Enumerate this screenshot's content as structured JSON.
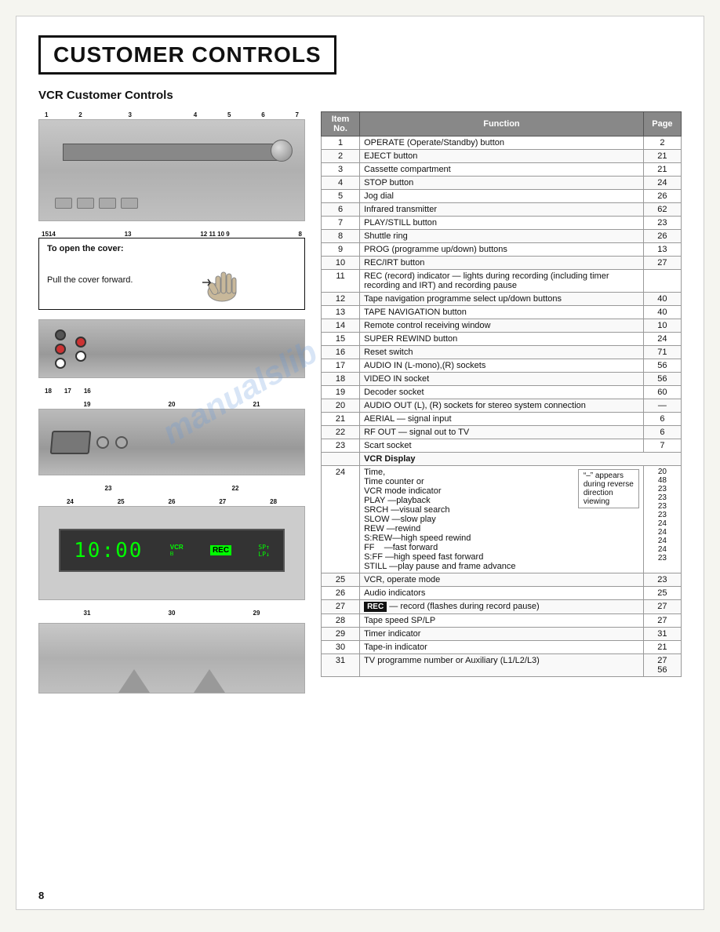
{
  "page": {
    "title": "CUSTOMER CONTROLS",
    "section_title": "VCR Customer Controls",
    "page_number": "8"
  },
  "cover_note": {
    "title": "To open the cover:",
    "text": "Pull the cover forward."
  },
  "top_diagram_numbers": {
    "top_row": [
      "1",
      "2",
      "3",
      "4",
      "5",
      "6",
      "7"
    ],
    "bottom_row": [
      "1514",
      "13",
      "1211 10  9",
      "8"
    ]
  },
  "back_diagram_numbers": [
    "18",
    "17",
    "16"
  ],
  "connector_diagram_numbers": [
    "19",
    "20",
    "21",
    "23",
    "22"
  ],
  "display_diagram_numbers": {
    "top_row": [
      "24",
      "25",
      "26",
      "27",
      "28"
    ],
    "bottom_row": [
      "31",
      "30",
      "29"
    ]
  },
  "table": {
    "headers": [
      "Item No.",
      "Function",
      "Page"
    ],
    "rows": [
      {
        "item": "1",
        "function": "OPERATE (Operate/Standby) button",
        "page": "2"
      },
      {
        "item": "2",
        "function": "EJECT button",
        "page": "21"
      },
      {
        "item": "3",
        "function": "Cassette compartment",
        "page": "21"
      },
      {
        "item": "4",
        "function": "STOP button",
        "page": "24"
      },
      {
        "item": "5",
        "function": "Jog dial",
        "page": "26"
      },
      {
        "item": "6",
        "function": "Infrared transmitter",
        "page": "62"
      },
      {
        "item": "7",
        "function": "PLAY/STILL button",
        "page": "23"
      },
      {
        "item": "8",
        "function": "Shuttle ring",
        "page": "26"
      },
      {
        "item": "9",
        "function": "PROG (programme up/down) buttons",
        "page": "13"
      },
      {
        "item": "10",
        "function": "REC/IRT button",
        "page": "27"
      },
      {
        "item": "11",
        "function": "REC (record) indicator — lights during recording (including timer recording and IRT) and recording pause",
        "page": ""
      },
      {
        "item": "12",
        "function": "Tape navigation programme select up/down buttons",
        "page": "40"
      },
      {
        "item": "13",
        "function": "TAPE NAVIGATION button",
        "page": "40"
      },
      {
        "item": "14",
        "function": "Remote control receiving window",
        "page": "10"
      },
      {
        "item": "15",
        "function": "SUPER REWIND button",
        "page": "24"
      },
      {
        "item": "16",
        "function": "Reset switch",
        "page": "71"
      },
      {
        "item": "17",
        "function": "AUDIO IN (L-mono),(R) sockets",
        "page": "56"
      },
      {
        "item": "18",
        "function": "VIDEO IN socket",
        "page": "56"
      },
      {
        "item": "19",
        "function": "Decoder socket",
        "page": "60"
      },
      {
        "item": "20",
        "function": "AUDIO OUT (L), (R) sockets for stereo system connection",
        "page": "—"
      },
      {
        "item": "21",
        "function": "AERIAL — signal input",
        "page": "6"
      },
      {
        "item": "22",
        "function": "RF OUT — signal out to TV",
        "page": "6"
      },
      {
        "item": "23",
        "function": "Scart socket",
        "page": "7"
      },
      {
        "item": "vcr_display_header",
        "function": "VCR Display",
        "page": ""
      },
      {
        "item": "24",
        "function": "Time,\nTime counter or\nVCR mode indicator\nPLAY  —playback\nSRCH —visual search\nSLOW —slow play\nREW  —rewind\nS:REW—high speed rewind\nFF    —fast forward\nS:FF  —high speed fast forward\nSTILL —play pause and frame advance",
        "page": "20\n48\n23\n23\n23\n23\n24\n24\n24\n24\n23",
        "bracket": "\"–\" appears\nduring reverse\ndirection\nviewing"
      },
      {
        "item": "25",
        "function": "VCR, operate mode",
        "page": "23"
      },
      {
        "item": "26",
        "function": "Audio indicators",
        "page": "25"
      },
      {
        "item": "27",
        "function": "REC — record (flashes during record pause)",
        "page": "27"
      },
      {
        "item": "28",
        "function": "Tape speed SP/LP",
        "page": "27"
      },
      {
        "item": "29",
        "function": "Timer indicator",
        "page": "31"
      },
      {
        "item": "30",
        "function": "Tape-in indicator",
        "page": "21"
      },
      {
        "item": "31",
        "function": "TV programme number or Auxiliary (L1/L2/L3)",
        "page": "27\n56"
      }
    ]
  }
}
